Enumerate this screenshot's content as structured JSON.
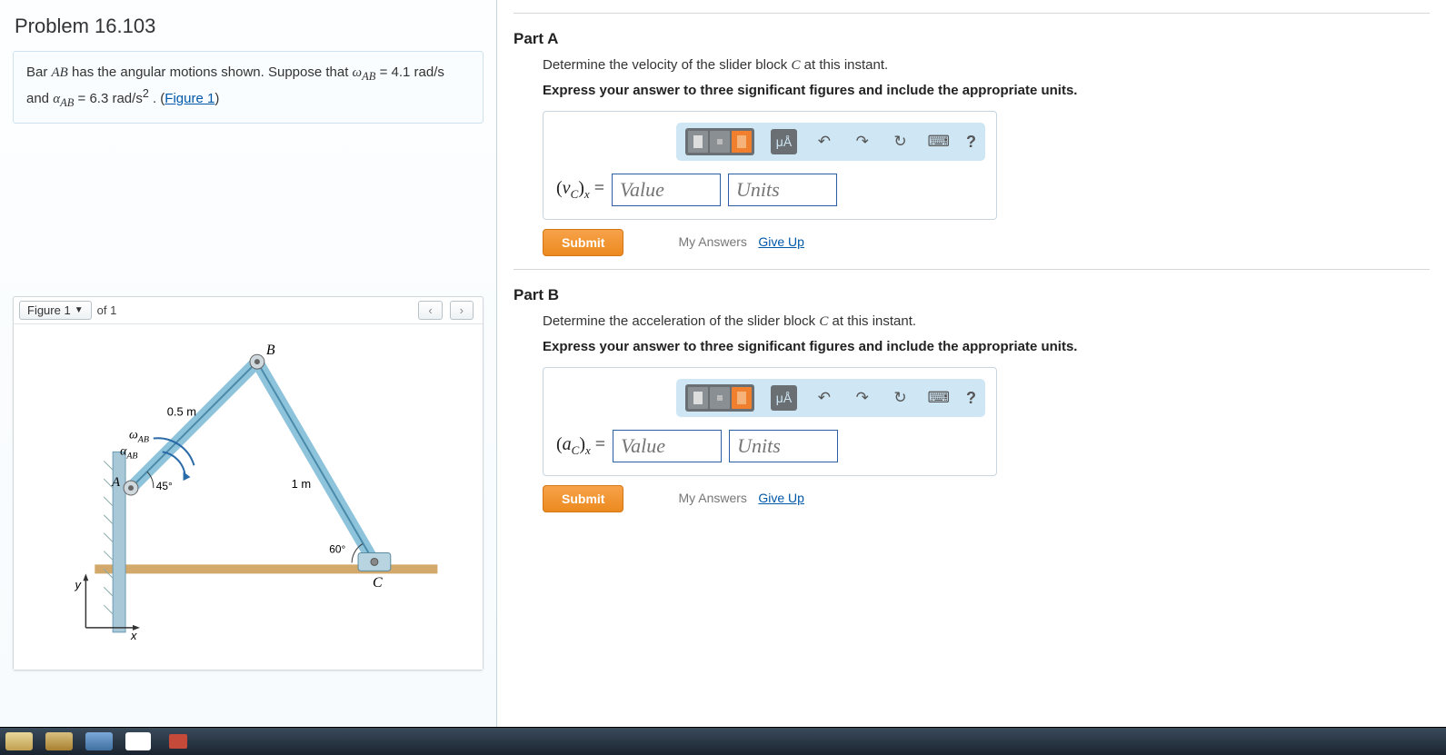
{
  "problem": {
    "title": "Problem 16.103",
    "text_prefix": "Bar ",
    "bar_name": "AB",
    "text_mid": " has the angular motions shown. Suppose that ",
    "omega_sym": "ω",
    "omega_sub": "AB",
    "omega_eq": " = 4.1  rad/s",
    "text_and": " and ",
    "alpha_sym": "α",
    "alpha_sub": "AB",
    "alpha_eq": " = 6.3  rad/s",
    "alpha_sup": "2",
    "text_period": " . (",
    "figure_link": "Figure 1",
    "text_close": ")"
  },
  "figure": {
    "button_label": "Figure 1",
    "of_text": "of 1",
    "prev": "‹",
    "next": "›",
    "labels": {
      "B": "B",
      "A": "A",
      "C": "C",
      "len1": "0.5 m",
      "len2": "1 m",
      "ang1": "45°",
      "ang2": "60°",
      "omega": "ω",
      "alpha": "α",
      "sub": "AB",
      "x": "x",
      "y": "y"
    }
  },
  "partA": {
    "title": "Part A",
    "prompt_pre": "Determine the velocity of the slider block ",
    "C": "C",
    "prompt_post": " at this instant.",
    "instruction": "Express your answer to three significant figures and include the appropriate units.",
    "var_html": "(<i>v</i><sub>C</sub>)<sub><i>x</i></sub> =",
    "value_ph": "Value",
    "units_ph": "Units",
    "toolbar_units": "μÅ"
  },
  "partB": {
    "title": "Part B",
    "prompt_pre": "Determine the acceleration of the slider block ",
    "C": "C",
    "prompt_post": " at this instant.",
    "instruction": "Express your answer to three significant figures and include the appropriate units.",
    "var_html": "(<i>a</i><sub>C</sub>)<sub><i>x</i></sub> =",
    "value_ph": "Value",
    "units_ph": "Units",
    "toolbar_units": "μÅ"
  },
  "actions": {
    "submit": "Submit",
    "my_answers": "My Answers",
    "give_up": "Give Up",
    "help": "?"
  }
}
